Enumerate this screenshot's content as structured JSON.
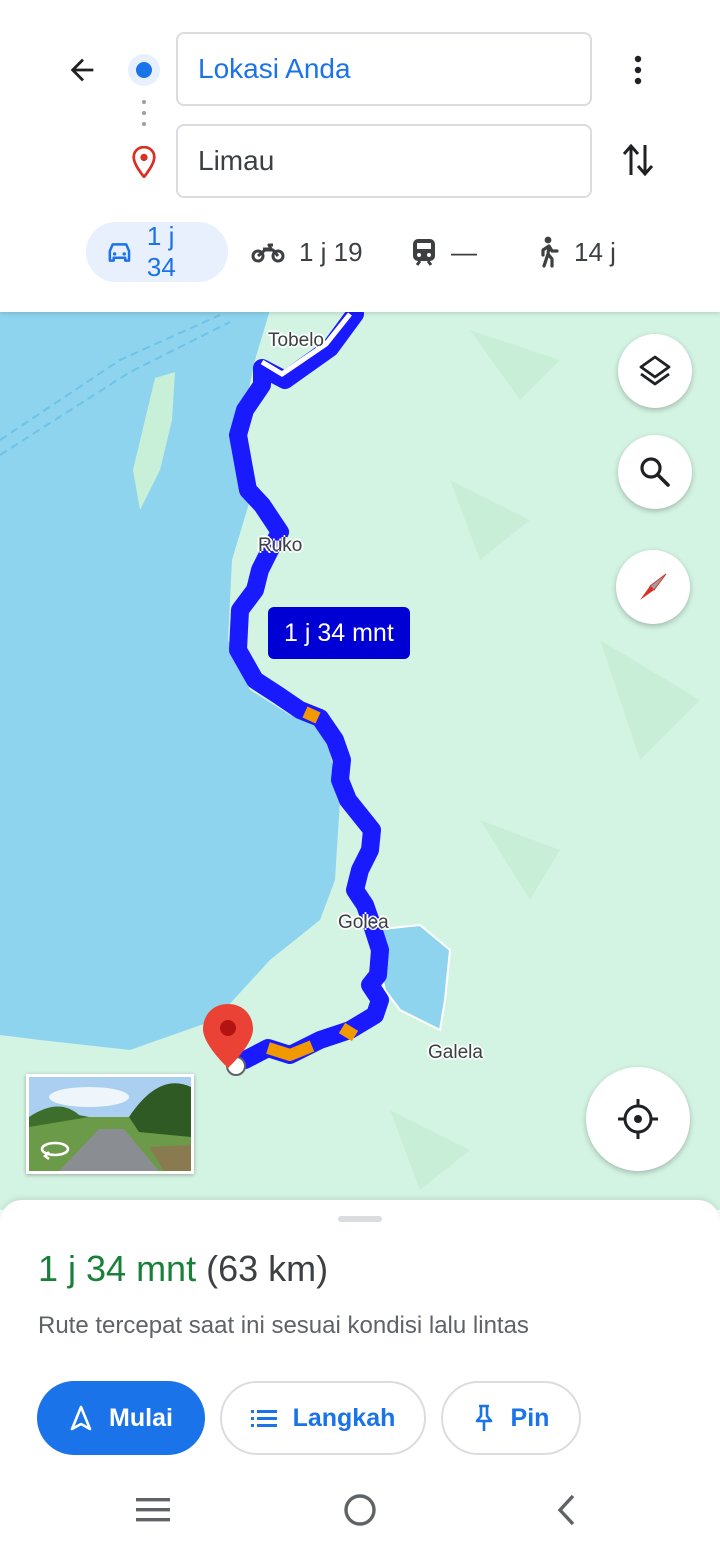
{
  "header": {
    "origin_value": "Lokasi Anda",
    "destination_value": "Limau",
    "icons": {
      "back": "arrow-left-icon",
      "origin": "origin-dot-icon",
      "destination": "location-pin-icon",
      "more": "more-vert-icon",
      "swap": "swap-vert-icon"
    }
  },
  "travel_modes": [
    {
      "mode": "car",
      "label": "1 j 34",
      "selected": true,
      "icon": "car-icon"
    },
    {
      "mode": "motorcycle",
      "label": "1 j 19",
      "selected": false,
      "icon": "motorcycle-icon"
    },
    {
      "mode": "transit",
      "label": "—",
      "selected": false,
      "icon": "train-icon"
    },
    {
      "mode": "walk",
      "label": "14 j",
      "selected": false,
      "icon": "walk-icon"
    }
  ],
  "map": {
    "places": [
      "Tobelo",
      "Ruko",
      "Golea",
      "Galela"
    ],
    "route_eta": "1 j 34 mnt",
    "colors": {
      "route": "#1a1aff",
      "traffic_slow": "#f29900",
      "water": "#8fd4ee",
      "land": "#d4f4e3"
    },
    "controls": [
      "layers-icon",
      "search-icon",
      "compass-icon",
      "my-location-icon"
    ]
  },
  "sheet": {
    "duration": "1 j 34 mnt",
    "distance": "(63 km)",
    "note": "Rute tercepat saat ini sesuai kondisi lalu lintas",
    "buttons": {
      "start": "Mulai",
      "steps": "Langkah",
      "pin": "Pin"
    }
  },
  "system_nav": [
    "recent-apps-icon",
    "home-icon",
    "back-icon"
  ]
}
